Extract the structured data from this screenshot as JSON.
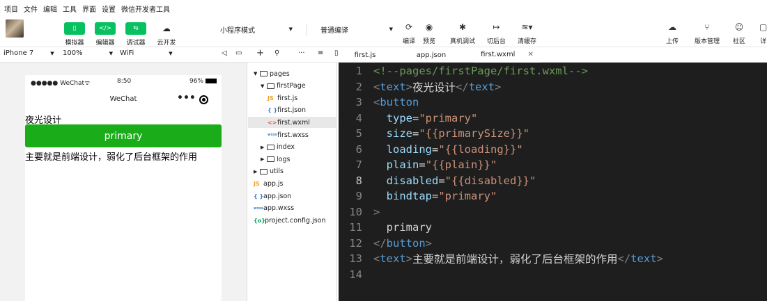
{
  "menu": [
    "项目",
    "文件",
    "编辑",
    "工具",
    "界面",
    "设置",
    "微信开发者工具"
  ],
  "toolbar": {
    "simulator": "模拟器",
    "editor": "编辑器",
    "debugger": "调试器",
    "cloud": "云开发",
    "mode_select": "小程序模式",
    "compile_select": "普通编译",
    "compile": "编译",
    "preview": "预览",
    "real_debug": "真机调试",
    "background": "切后台",
    "clear_cache": "清缓存",
    "upload": "上传",
    "version": "版本管理",
    "community": "社区",
    "more": "详"
  },
  "device_bar": {
    "device": "iPhone 7",
    "zoom": "100%",
    "network": "WiFi"
  },
  "tabs": [
    "first.js",
    "app.json",
    "first.wxml"
  ],
  "active_tab": "first.wxml",
  "phone": {
    "carrier": "●●●●● WeChat",
    "time": "8:50",
    "battery": "96%",
    "nav_title": "WeChat",
    "text1": "夜光设计",
    "button_label": "primary",
    "text2": "主要就是前端设计，弱化了后台框架的作用"
  },
  "tree": [
    {
      "label": "pages",
      "type": "folder-open",
      "level": 0
    },
    {
      "label": "firstPage",
      "type": "folder-open",
      "level": 1
    },
    {
      "label": "first.js",
      "type": "js",
      "level": 2
    },
    {
      "label": "first.json",
      "type": "json",
      "level": 2
    },
    {
      "label": "first.wxml",
      "type": "wxml",
      "level": 2
    },
    {
      "label": "first.wxss",
      "type": "wxss",
      "level": 2
    },
    {
      "label": "index",
      "type": "folder",
      "level": 1
    },
    {
      "label": "logs",
      "type": "folder",
      "level": 1
    },
    {
      "label": "utils",
      "type": "folder",
      "level": 0
    },
    {
      "label": "app.js",
      "type": "js",
      "level": 0
    },
    {
      "label": "app.json",
      "type": "json",
      "level": 0
    },
    {
      "label": "app.wxss",
      "type": "wxss",
      "level": 0
    },
    {
      "label": "project.config.json",
      "type": "config",
      "level": 0
    }
  ],
  "file_icons": {
    "js": "JS",
    "json": "{ }",
    "wxml": "<>",
    "wxss": "wxss",
    "config": "{o}"
  },
  "code_lines": [
    [
      [
        "c-comment",
        "<!--pages/firstPage/first.wxml-->"
      ]
    ],
    [
      [
        "c-punc",
        "<"
      ],
      [
        "c-tag",
        "text"
      ],
      [
        "c-punc",
        ">"
      ],
      [
        "code",
        "夜光设计"
      ],
      [
        "c-punc",
        "</"
      ],
      [
        "c-tag",
        "text"
      ],
      [
        "c-punc",
        ">"
      ]
    ],
    [
      [
        "c-punc",
        "<"
      ],
      [
        "c-tag",
        "button"
      ]
    ],
    [
      [
        "code",
        "  "
      ],
      [
        "c-attr",
        "type"
      ],
      [
        "code",
        "="
      ],
      [
        "c-str",
        "\"primary\""
      ]
    ],
    [
      [
        "code",
        "  "
      ],
      [
        "c-attr",
        "size"
      ],
      [
        "code",
        "="
      ],
      [
        "c-str",
        "\"{{primarySize}}\""
      ]
    ],
    [
      [
        "code",
        "  "
      ],
      [
        "c-attr",
        "loading"
      ],
      [
        "code",
        "="
      ],
      [
        "c-str",
        "\"{{loading}}\""
      ]
    ],
    [
      [
        "code",
        "  "
      ],
      [
        "c-attr",
        "plain"
      ],
      [
        "code",
        "="
      ],
      [
        "c-str",
        "\"{{plain}}\""
      ]
    ],
    [
      [
        "code",
        "  "
      ],
      [
        "c-attr",
        "disabled"
      ],
      [
        "code",
        "="
      ],
      [
        "c-str",
        "\"{{disabled}}\""
      ]
    ],
    [
      [
        "code",
        "  "
      ],
      [
        "c-attr",
        "bindtap"
      ],
      [
        "code",
        "="
      ],
      [
        "c-str",
        "\"primary\""
      ]
    ],
    [
      [
        "c-punc",
        ">"
      ]
    ],
    [
      [
        "code",
        "  primary"
      ]
    ],
    [
      [
        "c-punc",
        "</"
      ],
      [
        "c-tag",
        "button"
      ],
      [
        "c-punc",
        ">"
      ]
    ],
    [
      [
        "c-punc",
        "<"
      ],
      [
        "c-tag",
        "text"
      ],
      [
        "c-punc",
        ">"
      ],
      [
        "code",
        "主要就是前端设计，弱化了后台框架的作用"
      ],
      [
        "c-punc",
        "</"
      ],
      [
        "c-tag",
        "text"
      ],
      [
        "c-punc",
        ">"
      ]
    ],
    []
  ],
  "current_line": 8,
  "colors": {
    "brand_green": "#07c160",
    "button_green": "#1aad19",
    "editor_bg": "#1e1e1e"
  }
}
